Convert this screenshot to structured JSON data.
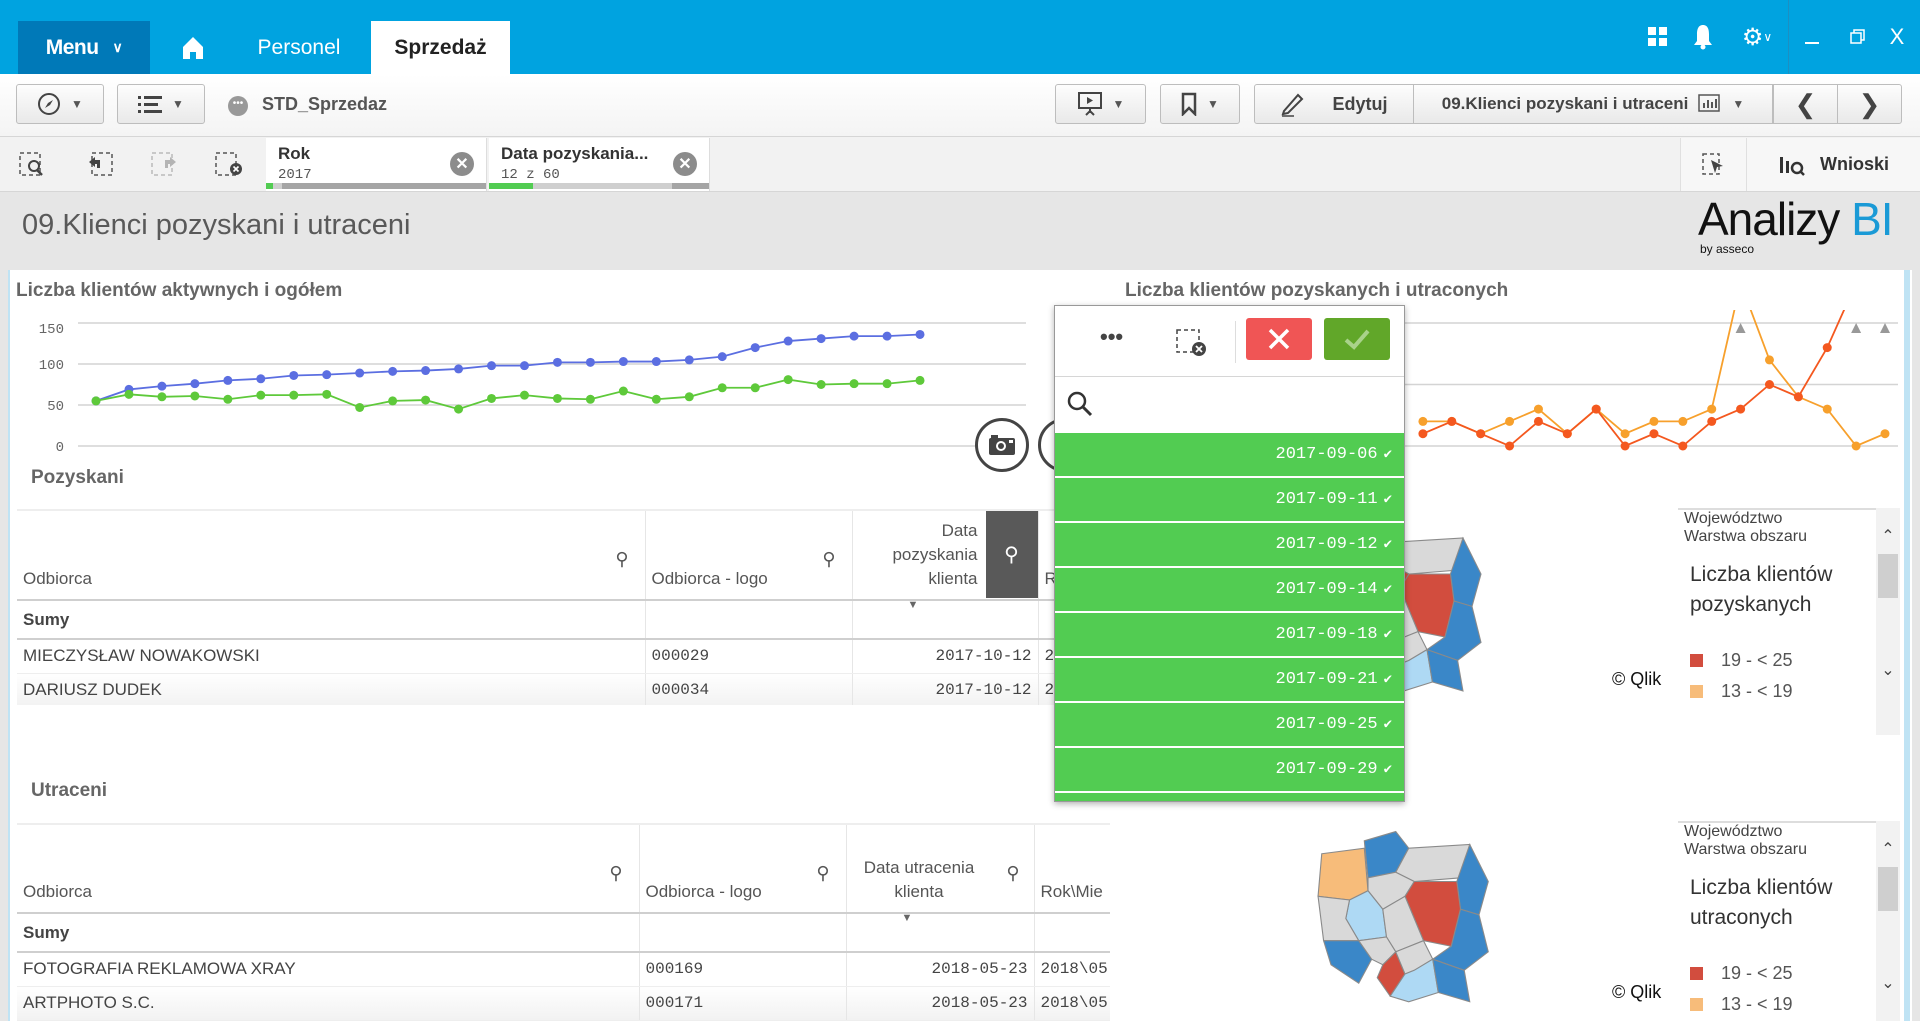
{
  "topbar": {
    "menu_label": "Menu",
    "tabs": [
      {
        "label": "Personel"
      },
      {
        "label": "Sprzedaż",
        "active": true
      }
    ],
    "icons": [
      "home-icon",
      "grid-icon",
      "bell-icon",
      "gear-icon",
      "minimize-icon",
      "restore-icon",
      "close-icon"
    ],
    "color": "#00a3e0"
  },
  "toolbar": {
    "app_name": "STD_Sprzedaz",
    "edit_label": "Edytuj",
    "sheet_selector": "09.Klienci pozyskani i utraceni"
  },
  "selections": {
    "tabs": [
      {
        "field": "Rok",
        "value": "2017",
        "selected_fraction": 0.03
      },
      {
        "field": "Data pozyskania...",
        "value": "12 z 60",
        "selected_fraction": 0.2
      }
    ],
    "insights_label": "Wnioski"
  },
  "sheet": {
    "title": "09.Klienci pozyskani i utraceni",
    "logo": {
      "text": "Analizy",
      "accent": "BI",
      "sub": "by asseco",
      "accent_color": "#1a9ad6"
    }
  },
  "chart_data": [
    {
      "type": "line",
      "title": "Liczba klientów aktywnych i ogółem",
      "ylim": [
        0,
        150
      ],
      "yticks": [
        "150",
        "100",
        "50",
        "0"
      ],
      "grid": true,
      "series": [
        {
          "color": "#5b6ee1",
          "values": [
            55,
            69,
            73,
            76,
            80,
            82,
            86,
            87,
            89,
            91,
            92,
            94,
            98,
            98,
            102,
            102,
            103,
            103,
            105,
            109,
            120,
            128,
            131,
            134,
            134,
            136
          ]
        },
        {
          "color": "#5ec93a",
          "values": [
            55,
            63,
            60,
            61,
            57,
            62,
            62,
            63,
            47,
            55,
            56,
            45,
            58,
            62,
            58,
            57,
            67,
            57,
            60,
            71,
            71,
            81,
            75,
            76,
            76,
            80
          ]
        }
      ]
    },
    {
      "type": "line",
      "title": "Liczba klientów pozyskanych i utraconych",
      "ylim": [
        0,
        20
      ],
      "grid": true,
      "series": [
        {
          "color": "#f7a02c",
          "values": [
            null,
            null,
            null,
            null,
            null,
            null,
            null,
            null,
            null,
            4,
            4,
            2,
            4,
            6,
            2,
            6,
            2,
            4,
            4,
            6,
            null,
            14,
            8,
            6,
            0,
            2
          ],
          "above_range_indices": [
            20
          ]
        },
        {
          "color": "#f4581f",
          "values": [
            null,
            null,
            null,
            null,
            null,
            null,
            null,
            null,
            null,
            2,
            4,
            2,
            0,
            4,
            2,
            6,
            0,
            2,
            0,
            4,
            6,
            10,
            8,
            16,
            null,
            null
          ],
          "above_range_indices": [
            24,
            25
          ]
        }
      ]
    }
  ],
  "pozyskani": {
    "title": "Pozyskani",
    "columns": [
      "Odbiorca",
      "Odbiorca - logo",
      "Data pozyskania klienta",
      "R"
    ],
    "sum_label": "Sumy",
    "rows": [
      [
        "MIECZYSŁAW NOWAKOWSKI",
        "000029",
        "2017-10-12",
        "2"
      ],
      [
        "DARIUSZ DUDEK",
        "000034",
        "2017-10-12",
        "2"
      ]
    ]
  },
  "utraceni": {
    "title": "Utraceni",
    "columns": [
      "Odbiorca",
      "Odbiorca - logo",
      "Data utracenia klienta",
      "Rok\\Mie"
    ],
    "sum_label": "Sumy",
    "rows": [
      [
        "FOTOGRAFIA REKLAMOWA XRAY",
        "000169",
        "2018-05-23",
        "2018\\05"
      ],
      [
        "ARTPHOTO S.C.",
        "000171",
        "2018-05-23",
        "2018\\05"
      ]
    ]
  },
  "listbox": {
    "items": [
      "2017-09-06",
      "2017-09-11",
      "2017-09-12",
      "2017-09-14",
      "2017-09-18",
      "2017-09-21",
      "2017-09-25",
      "2017-09-29"
    ],
    "selected_color": "#52cc52"
  },
  "maps": [
    {
      "legend_header1": "Województwo",
      "legend_header2": "Warstwa obszaru",
      "legend_title": "Liczba klientów pozyskanych",
      "legend_items": [
        {
          "label": "19 - < 25",
          "color": "#d24d3e"
        },
        {
          "label": "13 - < 19",
          "color": "#f7bc7a"
        }
      ],
      "copyright": "© Qlik",
      "fills": [
        "#d9d9d9",
        "#d9d9d9",
        "#d9d9d9",
        "#3a87c8",
        "#d24d3e",
        "#d9d9d9",
        "#d9d9d9",
        "#d24d3e",
        "#d9d9d9",
        "#d9d9d9",
        "#d9d9d9",
        "#d24d3e",
        "#d9d9d9",
        "#3a87c8",
        "#aed9f4",
        "#3a87c8"
      ]
    },
    {
      "legend_header1": "Województwo",
      "legend_header2": "Warstwa obszaru",
      "legend_title": "Liczba klientów utraconych",
      "legend_items": [
        {
          "label": "19 - < 25",
          "color": "#d24d3e"
        },
        {
          "label": "13 - < 19",
          "color": "#f7bc7a"
        }
      ],
      "copyright": "© Qlik",
      "fills": [
        "#f7bc7a",
        "#3a87c8",
        "#d9d9d9",
        "#3a87c8",
        "#d9d9d9",
        "#aed9f4",
        "#d9d9d9",
        "#d24d3e",
        "#d9d9d9",
        "#3a87c8",
        "#d9d9d9",
        "#d24d3e",
        "#d9d9d9",
        "#3a87c8",
        "#aed9f4",
        "#3a87c8"
      ]
    }
  ]
}
